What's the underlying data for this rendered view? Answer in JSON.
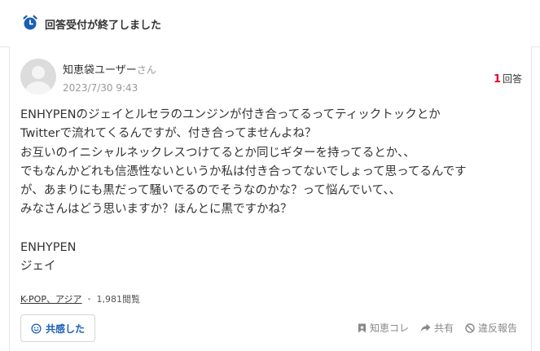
{
  "banner": {
    "title": "回答受付が終了しました",
    "icon": "alarm-clock-icon",
    "icon_color": "#1a5fb4"
  },
  "question": {
    "user": {
      "name": "知恵袋ユーザー",
      "honorific": "さん"
    },
    "date": "2023/7/30 9:43",
    "answer_count": "1",
    "answer_label": "回答",
    "body_lines": [
      "ENHYPENのジェイとルセラのユンジンが付き合ってるってティックトックとか",
      "Twitterで流れてくるんですが、付き合ってませんよね？",
      "お互いのイニシャルネックレスつけてるとか同じギターを持ってるとか、、",
      "でもなんかどれも信憑性ないというか私は付き合ってないでしょって思ってるんです",
      "が、あまりにも黒だって騒いでるのでそうなのかな？って悩んでいて、、",
      "みなさんはどう思いますか？ほんとに黒ですかね？",
      "",
      "ENHYPEN",
      "ジェイ"
    ],
    "categories": "K-POP、アジア",
    "separator": "・",
    "views": "1,981閲覧"
  },
  "actions": {
    "empathy_label": "共感した",
    "bookmark_label": "知恵コレ",
    "share_label": "共有",
    "report_label": "違反報告"
  },
  "colors": {
    "accent": "#1a5fb4",
    "answer_count": "#e60033"
  }
}
